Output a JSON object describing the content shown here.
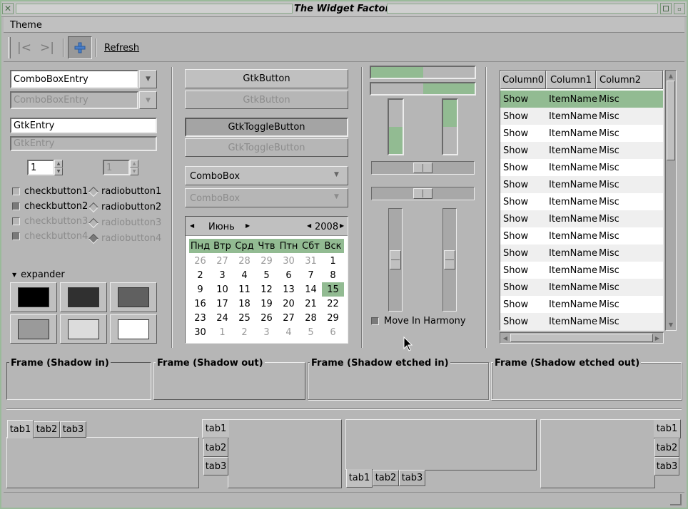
{
  "window": {
    "title": "The Widget Factory"
  },
  "menubar": {
    "theme": "Theme"
  },
  "toolbar": {
    "refresh": "Refresh"
  },
  "combo_entry": {
    "value1": "ComboBoxEntry",
    "value2": "ComboBoxEntry"
  },
  "entry": {
    "value1": "GtkEntry",
    "value2": "GtkEntry"
  },
  "spin": {
    "value1": "1",
    "value2": "1"
  },
  "checks": [
    "checkbutton1",
    "checkbutton2",
    "checkbutton3",
    "checkbutton4"
  ],
  "radios": [
    "radiobutton1",
    "radiobutton2",
    "radiobutton3",
    "radiobutton4"
  ],
  "expander": {
    "label": "expander"
  },
  "swatches": [
    "#000000",
    "#303030",
    "#606060",
    "#9a9a9a",
    "#dcdcdc",
    "#ffffff"
  ],
  "buttons": {
    "button1": "GtkButton",
    "button2": "GtkButton",
    "toggle1": "GtkToggleButton",
    "toggle2": "GtkToggleButton",
    "combo1": "ComboBox",
    "combo2": "ComboBox"
  },
  "calendar": {
    "month": "Июнь",
    "year": "2008",
    "weekdays": [
      "Пнд",
      "Втр",
      "Срд",
      "Чтв",
      "Птн",
      "Сбт",
      "Вск"
    ],
    "rows": [
      [
        "26",
        "27",
        "28",
        "29",
        "30",
        "31",
        "1"
      ],
      [
        "2",
        "3",
        "4",
        "5",
        "6",
        "7",
        "8"
      ],
      [
        "9",
        "10",
        "11",
        "12",
        "13",
        "14",
        "15"
      ],
      [
        "16",
        "17",
        "18",
        "19",
        "20",
        "21",
        "22"
      ],
      [
        "23",
        "24",
        "25",
        "26",
        "27",
        "28",
        "29"
      ],
      [
        "30",
        "1",
        "2",
        "3",
        "4",
        "5",
        "6"
      ]
    ],
    "selected": "15"
  },
  "progress": {
    "h1": 0.5,
    "h2": 0.5,
    "v1": 0.5,
    "v2": 0.5
  },
  "harmony": {
    "label": "Move In Harmony"
  },
  "tree": {
    "columns": [
      "Column0",
      "Column1",
      "Column2"
    ],
    "rows": [
      [
        "Show",
        "ItemName",
        "Misc"
      ],
      [
        "Show",
        "ItemName",
        "Misc"
      ],
      [
        "Show",
        "ItemName",
        "Misc"
      ],
      [
        "Show",
        "ItemName",
        "Misc"
      ],
      [
        "Show",
        "ItemName",
        "Misc"
      ],
      [
        "Show",
        "ItemName",
        "Misc"
      ],
      [
        "Show",
        "ItemName",
        "Misc"
      ],
      [
        "Show",
        "ItemName",
        "Misc"
      ],
      [
        "Show",
        "ItemName",
        "Misc"
      ],
      [
        "Show",
        "ItemName",
        "Misc"
      ],
      [
        "Show",
        "ItemName",
        "Misc"
      ],
      [
        "Show",
        "ItemName",
        "Misc"
      ],
      [
        "Show",
        "ItemName",
        "Misc"
      ],
      [
        "Show",
        "ItemName",
        "Misc"
      ]
    ]
  },
  "frames": [
    "Frame (Shadow in)",
    "Frame (Shadow out)",
    "Frame (Shadow etched in)",
    "Frame (Shadow etched out)"
  ],
  "tabs": [
    "tab1",
    "tab2",
    "tab3"
  ],
  "colors": {
    "accent": "#92bb92",
    "window_bg": "#b6b6b6",
    "titlebar": "#c2c2c2"
  }
}
